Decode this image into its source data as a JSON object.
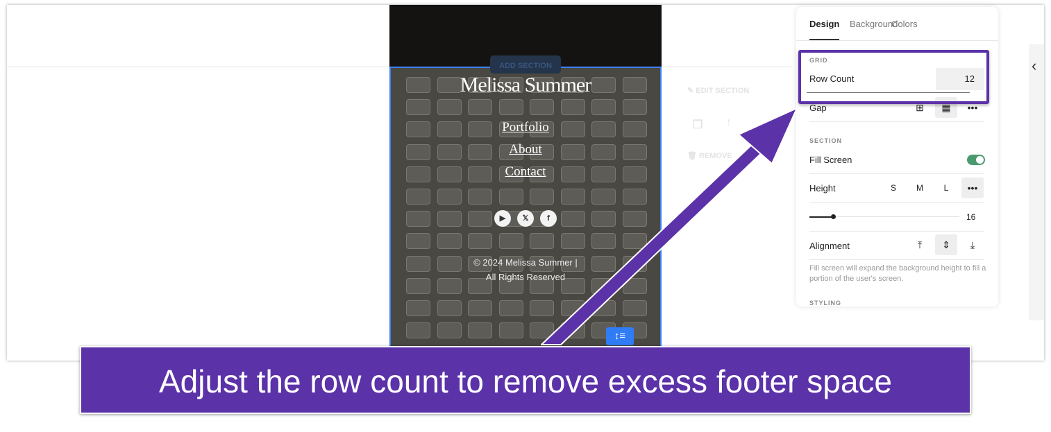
{
  "site": {
    "title": "Melissa Summer",
    "nav": [
      "Portfolio",
      "About",
      "Contact"
    ],
    "social": [
      {
        "icon": "youtube-icon",
        "glyph": "▶"
      },
      {
        "icon": "x-icon",
        "glyph": "𝕏"
      },
      {
        "icon": "facebook-icon",
        "glyph": "f"
      }
    ],
    "copyright_line1": "© 2024 Melissa Summer |",
    "copyright_line2": "All Rights Reserved",
    "grid_rows": 12,
    "grid_cols": 8
  },
  "ghost": {
    "add_section": "ADD SECTION",
    "edit_section": "EDIT SECTION",
    "remove": "REMOVE"
  },
  "panel": {
    "tabs": [
      "Design",
      "Background",
      "Colors"
    ],
    "active_tab": "Design",
    "grid_heading": "GRID",
    "row_count_label": "Row Count",
    "row_count_value": "12",
    "gap_label": "Gap",
    "section_heading": "SECTION",
    "fill_screen_label": "Fill Screen",
    "fill_screen_on": true,
    "height_label": "Height",
    "height_options": [
      "S",
      "M",
      "L",
      "•••"
    ],
    "slider_value": "16",
    "alignment_label": "Alignment",
    "help_text": "Fill screen will expand the background height to fill a portion of the user's screen.",
    "styling_heading": "STYLING",
    "accent": "#4a9a6e"
  },
  "caption": "Adjust the row count to remove excess footer space",
  "colors": {
    "annotation": "#5b32a8",
    "selection": "#3b82f6"
  }
}
